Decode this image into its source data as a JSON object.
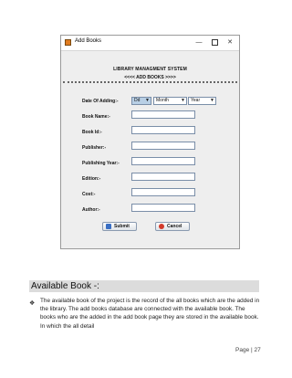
{
  "window": {
    "title": "Add Books",
    "controls": {
      "minimize": "—",
      "close": "✕"
    },
    "icon": "app-icon"
  },
  "form": {
    "system_title": "LIBRARY MANAGMENT SYSTEM",
    "subtitle": "<<<< ADD BOOKS >>>>",
    "date_label": "Date Of Adding:-",
    "date_day": "Dd",
    "date_month": "Month",
    "date_year": "Year",
    "fields": [
      {
        "label": "Book Name:-",
        "value": ""
      },
      {
        "label": "Book Id:-",
        "value": ""
      },
      {
        "label": "Publisher:-",
        "value": ""
      },
      {
        "label": "Publishing Year:-",
        "value": ""
      },
      {
        "label": "Edition:-",
        "value": ""
      },
      {
        "label": "Cost:-",
        "value": ""
      },
      {
        "label": "Author:-",
        "value": ""
      }
    ],
    "submit_label": "Submit",
    "cancel_label": "Cancel"
  },
  "document": {
    "section_heading": "Available Book -:",
    "paragraph": "The available book of the project is the record of the all books which are the added in the library. The add books database are connected with the available book. The books who are the added in the add book page they are stored in the available book. In which the all detail",
    "page_number": "Page | 27"
  },
  "colors": {
    "window_bg": "#eeeeee",
    "heading_bg": "#dcdcdc",
    "submit_icon": "#3a6fc4",
    "cancel_icon": "#d23a2a"
  }
}
